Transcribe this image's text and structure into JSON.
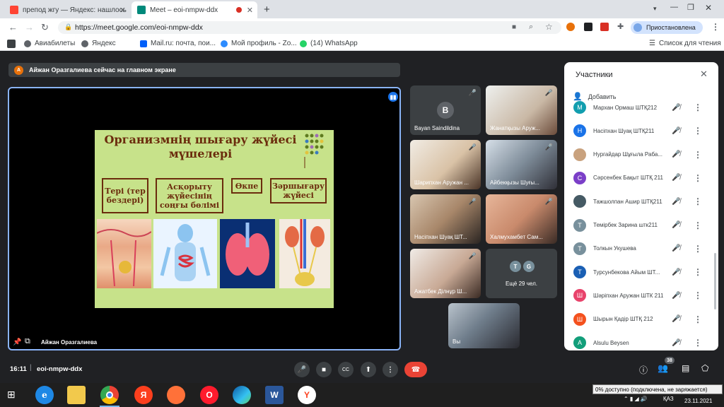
{
  "tabs": [
    {
      "title": "препод жгу — Яндекс: нашлось",
      "icon": "yandex-icon",
      "color": "#f43"
    },
    {
      "title": "Meet – eoi-nmpw-ddx",
      "icon": "meet-icon",
      "color": "#00897b"
    }
  ],
  "address": {
    "url": "https://meet.google.com/eoi-nmpw-ddx",
    "profile": "Приостановлена"
  },
  "bookmarks": [
    "Авиабилеты",
    "Яндекс",
    "Mail.ru: почта, пои...",
    "Мой профиль - Zo...",
    "(14) WhatsApp"
  ],
  "reading_list": "Список для чтения",
  "banner": {
    "initial": "А",
    "text": "Айжан Оразгалиева сейчас на главном экране"
  },
  "slide": {
    "title": "Организмнің шығару жүйесі мүшелері",
    "words": [
      "Тері (тер бездері)",
      "Асқорыту жүйесінің соңғы бөлімі",
      "Өкпе",
      "Зәршығару жүйесі"
    ]
  },
  "presenter": "Айжан Оразгалиева",
  "tiles": [
    {
      "name": "Bayan Saindildina",
      "initial": "B"
    },
    {
      "name": "Жанатқызы Аруж..."
    },
    {
      "name": "Шарипхан Аружан ..."
    },
    {
      "name": "Айбекқызы Шуғы..."
    },
    {
      "name": "Насіпхан Шуақ ШТ..."
    },
    {
      "name": "Халмухамбет Сам..."
    },
    {
      "name": "Ажатбек Ділнұр Ш..."
    },
    {
      "name": "Ещё 29 чел.",
      "initials": [
        "T",
        "G"
      ]
    },
    {
      "name": "Вы"
    }
  ],
  "panel": {
    "title": "Участники",
    "add": "Добавить",
    "people": [
      {
        "name": "Мархан Ормаш ШТҚ212",
        "initial": "М",
        "color": "#129eaf"
      },
      {
        "name": "Насіпхан Шуақ ШТҚ211",
        "initial": "Н",
        "color": "#1a73e8"
      },
      {
        "name": "Нургайдар Шұғыла Раба...",
        "initial": "",
        "color": "#c9a27e"
      },
      {
        "name": "Сәрсенбек Бақыт ШТҚ 211",
        "initial": "С",
        "color": "#7b3fc8"
      },
      {
        "name": "Тажшолпан Ашир ШТҚ211",
        "initial": "",
        "color": "#455a64"
      },
      {
        "name": "Темірбек Зарина штк211",
        "initial": "Т",
        "color": "#78909c"
      },
      {
        "name": "Толкын Укушева",
        "initial": "Т",
        "color": "#78909c"
      },
      {
        "name": "Турсунбекова Айым ШТ...",
        "initial": "Т",
        "color": "#1a5fb4"
      },
      {
        "name": "Шәріпхан Аружан ШТК 211",
        "initial": "Ш",
        "color": "#e8436b"
      },
      {
        "name": "Шырын Қадір ШТҚ 212",
        "initial": "Ш",
        "color": "#f4511e"
      },
      {
        "name": "Alsulu Beysen",
        "initial": "A",
        "color": "#129e7a"
      }
    ]
  },
  "bottom": {
    "time": "16:11",
    "code": "eoi-nmpw-ddx",
    "count": "38"
  },
  "tray": {
    "lang": "ҚАЗ",
    "date": "23.11.2021",
    "tooltip": "0% доступно (подключена, не заряжается)"
  }
}
